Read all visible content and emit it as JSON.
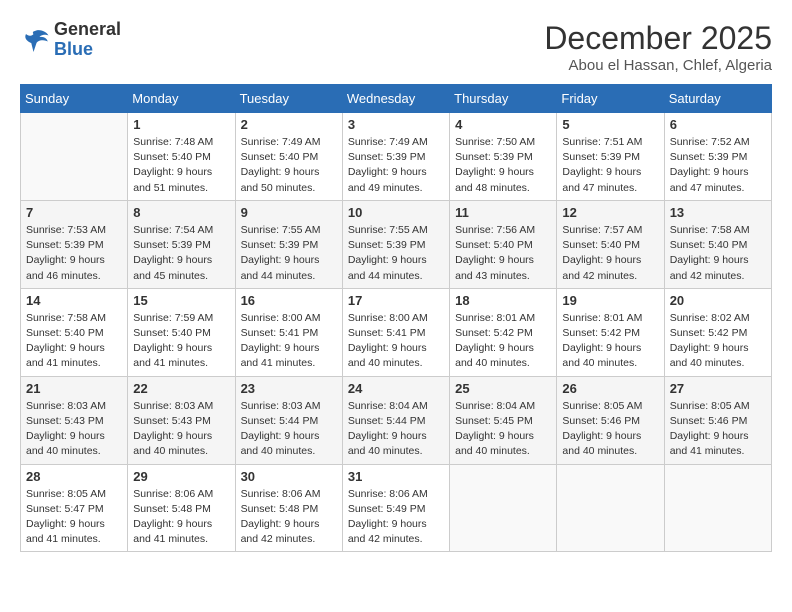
{
  "header": {
    "logo_line1": "General",
    "logo_line2": "Blue",
    "month": "December 2025",
    "location": "Abou el Hassan, Chlef, Algeria"
  },
  "weekdays": [
    "Sunday",
    "Monday",
    "Tuesday",
    "Wednesday",
    "Thursday",
    "Friday",
    "Saturday"
  ],
  "weeks": [
    [
      {
        "day": "",
        "info": ""
      },
      {
        "day": "1",
        "info": "Sunrise: 7:48 AM\nSunset: 5:40 PM\nDaylight: 9 hours\nand 51 minutes."
      },
      {
        "day": "2",
        "info": "Sunrise: 7:49 AM\nSunset: 5:40 PM\nDaylight: 9 hours\nand 50 minutes."
      },
      {
        "day": "3",
        "info": "Sunrise: 7:49 AM\nSunset: 5:39 PM\nDaylight: 9 hours\nand 49 minutes."
      },
      {
        "day": "4",
        "info": "Sunrise: 7:50 AM\nSunset: 5:39 PM\nDaylight: 9 hours\nand 48 minutes."
      },
      {
        "day": "5",
        "info": "Sunrise: 7:51 AM\nSunset: 5:39 PM\nDaylight: 9 hours\nand 47 minutes."
      },
      {
        "day": "6",
        "info": "Sunrise: 7:52 AM\nSunset: 5:39 PM\nDaylight: 9 hours\nand 47 minutes."
      }
    ],
    [
      {
        "day": "7",
        "info": "Sunrise: 7:53 AM\nSunset: 5:39 PM\nDaylight: 9 hours\nand 46 minutes."
      },
      {
        "day": "8",
        "info": "Sunrise: 7:54 AM\nSunset: 5:39 PM\nDaylight: 9 hours\nand 45 minutes."
      },
      {
        "day": "9",
        "info": "Sunrise: 7:55 AM\nSunset: 5:39 PM\nDaylight: 9 hours\nand 44 minutes."
      },
      {
        "day": "10",
        "info": "Sunrise: 7:55 AM\nSunset: 5:39 PM\nDaylight: 9 hours\nand 44 minutes."
      },
      {
        "day": "11",
        "info": "Sunrise: 7:56 AM\nSunset: 5:40 PM\nDaylight: 9 hours\nand 43 minutes."
      },
      {
        "day": "12",
        "info": "Sunrise: 7:57 AM\nSunset: 5:40 PM\nDaylight: 9 hours\nand 42 minutes."
      },
      {
        "day": "13",
        "info": "Sunrise: 7:58 AM\nSunset: 5:40 PM\nDaylight: 9 hours\nand 42 minutes."
      }
    ],
    [
      {
        "day": "14",
        "info": "Sunrise: 7:58 AM\nSunset: 5:40 PM\nDaylight: 9 hours\nand 41 minutes."
      },
      {
        "day": "15",
        "info": "Sunrise: 7:59 AM\nSunset: 5:40 PM\nDaylight: 9 hours\nand 41 minutes."
      },
      {
        "day": "16",
        "info": "Sunrise: 8:00 AM\nSunset: 5:41 PM\nDaylight: 9 hours\nand 41 minutes."
      },
      {
        "day": "17",
        "info": "Sunrise: 8:00 AM\nSunset: 5:41 PM\nDaylight: 9 hours\nand 40 minutes."
      },
      {
        "day": "18",
        "info": "Sunrise: 8:01 AM\nSunset: 5:42 PM\nDaylight: 9 hours\nand 40 minutes."
      },
      {
        "day": "19",
        "info": "Sunrise: 8:01 AM\nSunset: 5:42 PM\nDaylight: 9 hours\nand 40 minutes."
      },
      {
        "day": "20",
        "info": "Sunrise: 8:02 AM\nSunset: 5:42 PM\nDaylight: 9 hours\nand 40 minutes."
      }
    ],
    [
      {
        "day": "21",
        "info": "Sunrise: 8:03 AM\nSunset: 5:43 PM\nDaylight: 9 hours\nand 40 minutes."
      },
      {
        "day": "22",
        "info": "Sunrise: 8:03 AM\nSunset: 5:43 PM\nDaylight: 9 hours\nand 40 minutes."
      },
      {
        "day": "23",
        "info": "Sunrise: 8:03 AM\nSunset: 5:44 PM\nDaylight: 9 hours\nand 40 minutes."
      },
      {
        "day": "24",
        "info": "Sunrise: 8:04 AM\nSunset: 5:44 PM\nDaylight: 9 hours\nand 40 minutes."
      },
      {
        "day": "25",
        "info": "Sunrise: 8:04 AM\nSunset: 5:45 PM\nDaylight: 9 hours\nand 40 minutes."
      },
      {
        "day": "26",
        "info": "Sunrise: 8:05 AM\nSunset: 5:46 PM\nDaylight: 9 hours\nand 40 minutes."
      },
      {
        "day": "27",
        "info": "Sunrise: 8:05 AM\nSunset: 5:46 PM\nDaylight: 9 hours\nand 41 minutes."
      }
    ],
    [
      {
        "day": "28",
        "info": "Sunrise: 8:05 AM\nSunset: 5:47 PM\nDaylight: 9 hours\nand 41 minutes."
      },
      {
        "day": "29",
        "info": "Sunrise: 8:06 AM\nSunset: 5:48 PM\nDaylight: 9 hours\nand 41 minutes."
      },
      {
        "day": "30",
        "info": "Sunrise: 8:06 AM\nSunset: 5:48 PM\nDaylight: 9 hours\nand 42 minutes."
      },
      {
        "day": "31",
        "info": "Sunrise: 8:06 AM\nSunset: 5:49 PM\nDaylight: 9 hours\nand 42 minutes."
      },
      {
        "day": "",
        "info": ""
      },
      {
        "day": "",
        "info": ""
      },
      {
        "day": "",
        "info": ""
      }
    ]
  ]
}
